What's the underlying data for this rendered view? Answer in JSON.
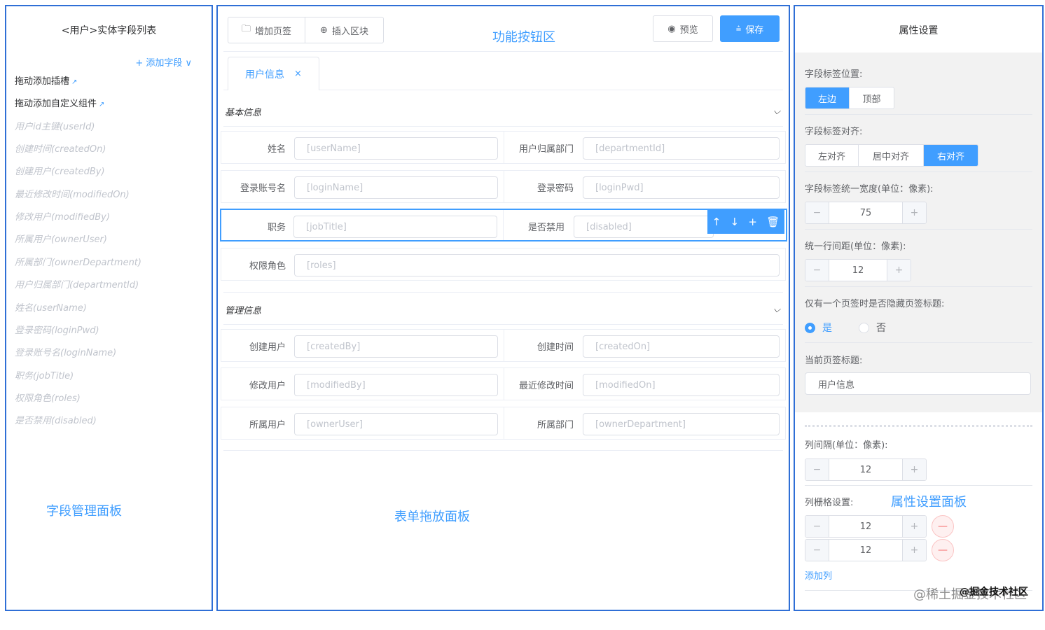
{
  "left": {
    "title": "<用户>实体字段列表",
    "add_field": "+ 添加字段 ∨",
    "drag_slot": "拖动添加插槽",
    "drag_custom": "拖动添加自定义组件",
    "ext_icon": "↗",
    "fields": [
      "用户id主键(userId)",
      "创建时间(createdOn)",
      "创建用户(createdBy)",
      "最近修改时间(modifiedOn)",
      "修改用户(modifiedBy)",
      "所属用户(ownerUser)",
      "所属部门(ownerDepartment)",
      "用户归属部门(departmentId)",
      "姓名(userName)",
      "登录密码(loginPwd)",
      "登录账号名(loginName)",
      "职务(jobTitle)",
      "权限角色(roles)",
      "是否禁用(disabled)"
    ],
    "panel_label": "字段管理面板"
  },
  "mid": {
    "buttons": {
      "add_tab": "增加页签",
      "insert_block": "插入区块",
      "preview": "预览",
      "save": "保存"
    },
    "func_label": "功能按钮区",
    "tab": {
      "label": "用户信息",
      "close": "×"
    },
    "sections": [
      {
        "title": "基本信息"
      },
      {
        "title": "管理信息"
      }
    ],
    "rows": [
      {
        "l1": "姓名",
        "v1": "[userName]",
        "l2": "用户归属部门",
        "v2": "[departmentId]"
      },
      {
        "l1": "登录账号名",
        "v1": "[loginName]",
        "l2": "登录密码",
        "v2": "[loginPwd]"
      },
      {
        "l1": "职务",
        "v1": "[jobTitle]",
        "l2": "是否禁用",
        "v2": "[disabled]"
      },
      {
        "l1": "权限角色",
        "v1": "[roles]"
      },
      {
        "l1": "创建用户",
        "v1": "[createdBy]",
        "l2": "创建时间",
        "v2": "[createdOn]"
      },
      {
        "l1": "修改用户",
        "v1": "[modifiedBy]",
        "l2": "最近修改时间",
        "v2": "[modifiedOn]"
      },
      {
        "l1": "所属用户",
        "v1": "[ownerUser]",
        "l2": "所属部门",
        "v2": "[ownerDepartment]"
      }
    ],
    "panel_label": "表单拖放面板"
  },
  "right": {
    "title": "属性设置",
    "label_pos": {
      "label": "字段标签位置:",
      "options": [
        "左边",
        "顶部"
      ],
      "selected": "左边"
    },
    "label_align": {
      "label": "字段标签对齐:",
      "options": [
        "左对齐",
        "居中对齐",
        "右对齐"
      ],
      "selected": "右对齐"
    },
    "label_width": {
      "label": "字段标签统一宽度(单位：像素):",
      "value": "75"
    },
    "row_gap": {
      "label": "统一行间距(单位：像素):",
      "value": "12"
    },
    "hide_title": {
      "label": "仅有一个页签时是否隐藏页签标题:",
      "yes": "是",
      "no": "否",
      "selected": "是"
    },
    "tab_title": {
      "label": "当前页签标题:",
      "value": "用户信息"
    },
    "col_gap": {
      "label": "列间隔(单位：像素):",
      "value": "12"
    },
    "col_grid": {
      "label": "列栅格设置:",
      "values": [
        "12",
        "12"
      ]
    },
    "add_col": "添加列",
    "panel_label": "属性设置面板",
    "watermark": "@稀土掘金技术社区",
    "watermark2": "@掘金技术社区"
  },
  "colors": {
    "accent": "#409eff",
    "frame": "#2f6fd6"
  }
}
